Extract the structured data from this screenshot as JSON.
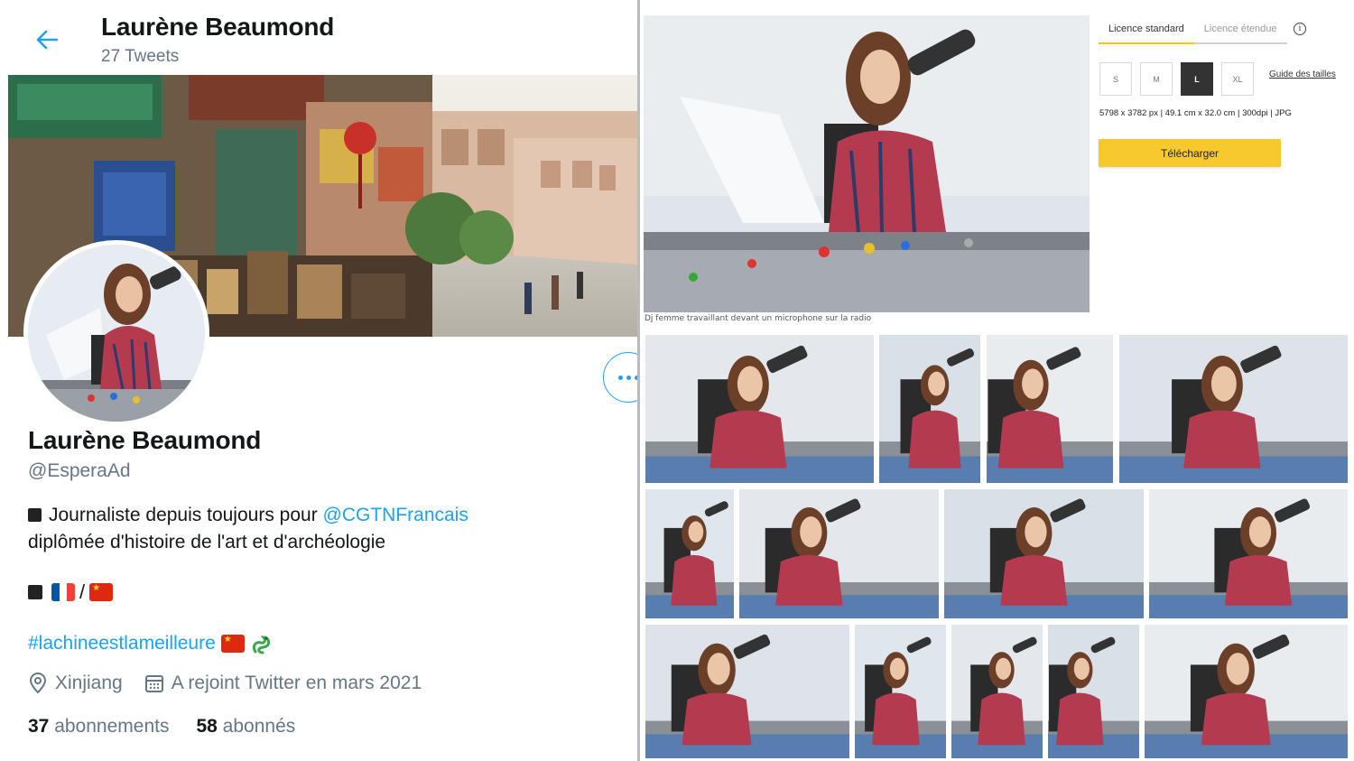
{
  "twitter": {
    "header": {
      "name": "Laurène Beaumond",
      "tweet_count": "27 Tweets"
    },
    "profile": {
      "name": "Laurène Beaumond",
      "handle": "@EsperaAd",
      "bio_line1_prefix": "Journaliste depuis toujours pour ",
      "bio_mention": "@CGTNFrancais",
      "bio_line2": "diplômée d'histoire de l'art et d'archéologie",
      "flags_separator": "/",
      "hashtag": "#lachineestlameilleure",
      "location": "Xinjiang",
      "joined": "A rejoint Twitter en mars 2021",
      "following_count": "37",
      "following_label": "abonnements",
      "followers_count": "58",
      "followers_label": "abonnés"
    },
    "colors": {
      "link": "#1da1f2",
      "secondary_text": "#657786"
    },
    "icons": [
      "back-arrow-icon",
      "more-options-icon",
      "location-icon",
      "calendar-icon"
    ]
  },
  "stock": {
    "main_caption": "Dj femme travaillant devant un microphone sur la radio",
    "license_tabs": [
      "Licence standard",
      "Licence étendue"
    ],
    "active_tab": "Licence standard",
    "sizes": [
      "S",
      "M",
      "L",
      "XL"
    ],
    "selected_size": "L",
    "size_guide": "Guide des tailles",
    "specs": "5798 x 3782 px | 49.1 cm x 32.0 cm | 300dpi | JPG",
    "download_label": "Télécharger",
    "colors": {
      "accent": "#f7c92e"
    }
  }
}
